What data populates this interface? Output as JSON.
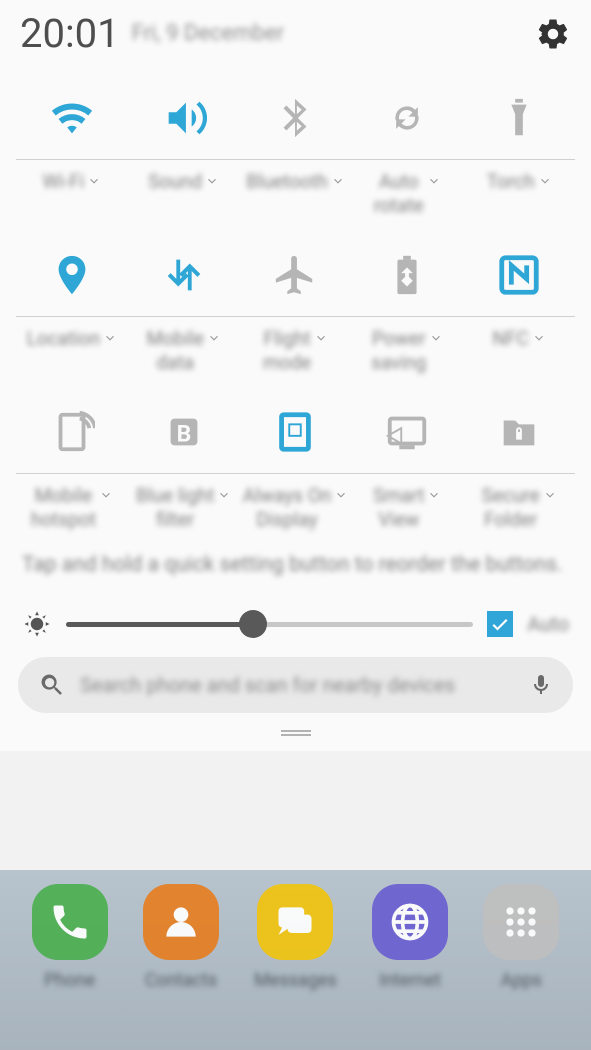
{
  "header": {
    "time": "20:01",
    "date": "Fri, 9 December"
  },
  "colors": {
    "active": "#2fa7d6",
    "inactive": "#b5b5b5",
    "text_muted": "#808080"
  },
  "quick_settings": [
    {
      "id": "wifi",
      "label": "Wi-Fi",
      "active": true,
      "icon": "wifi-icon"
    },
    {
      "id": "sound",
      "label": "Sound",
      "active": true,
      "icon": "sound-icon"
    },
    {
      "id": "bluetooth",
      "label": "Bluetooth",
      "active": false,
      "icon": "bluetooth-icon"
    },
    {
      "id": "auto-rotate",
      "label": "Auto\nrotate",
      "active": false,
      "icon": "rotate-icon"
    },
    {
      "id": "torch",
      "label": "Torch",
      "active": false,
      "icon": "torch-icon"
    },
    {
      "id": "location",
      "label": "Location",
      "active": true,
      "icon": "location-icon"
    },
    {
      "id": "mobile-data",
      "label": "Mobile\ndata",
      "active": true,
      "icon": "mobile-data-icon"
    },
    {
      "id": "flight-mode",
      "label": "Flight\nmode",
      "active": false,
      "icon": "airplane-icon"
    },
    {
      "id": "power-saving",
      "label": "Power\nsaving",
      "active": false,
      "icon": "battery-recycle-icon"
    },
    {
      "id": "nfc",
      "label": "NFC",
      "active": true,
      "icon": "nfc-icon"
    },
    {
      "id": "mobile-hotspot",
      "label": "Mobile\nhotspot",
      "active": false,
      "icon": "hotspot-icon"
    },
    {
      "id": "blue-light",
      "label": "Blue light\nfilter",
      "active": false,
      "icon": "blue-light-icon"
    },
    {
      "id": "aod",
      "label": "Always On\nDisplay",
      "active": true,
      "icon": "aod-icon"
    },
    {
      "id": "smart-view",
      "label": "Smart\nView",
      "active": false,
      "icon": "cast-icon"
    },
    {
      "id": "secure-folder",
      "label": "Secure\nFolder",
      "active": false,
      "icon": "secure-folder-icon"
    }
  ],
  "hint": "Tap and hold a quick setting button to reorder the buttons.",
  "brightness": {
    "value_percent": 46,
    "auto_checked": true,
    "auto_label": "Auto"
  },
  "search": {
    "placeholder": "Search phone and scan for nearby devices"
  },
  "dock": [
    {
      "id": "phone",
      "label": "Phone",
      "color": "#4caf50",
      "icon": "phone-icon"
    },
    {
      "id": "contacts",
      "label": "Contacts",
      "color": "#e67e22",
      "icon": "contacts-icon"
    },
    {
      "id": "messages",
      "label": "Messages",
      "color": "#f1c40f",
      "icon": "messages-icon"
    },
    {
      "id": "internet",
      "label": "Internet",
      "color": "#6b5fd0",
      "icon": "globe-icon"
    },
    {
      "id": "apps",
      "label": "Apps",
      "color": "#bfbfbf",
      "icon": "apps-grid-icon"
    }
  ]
}
